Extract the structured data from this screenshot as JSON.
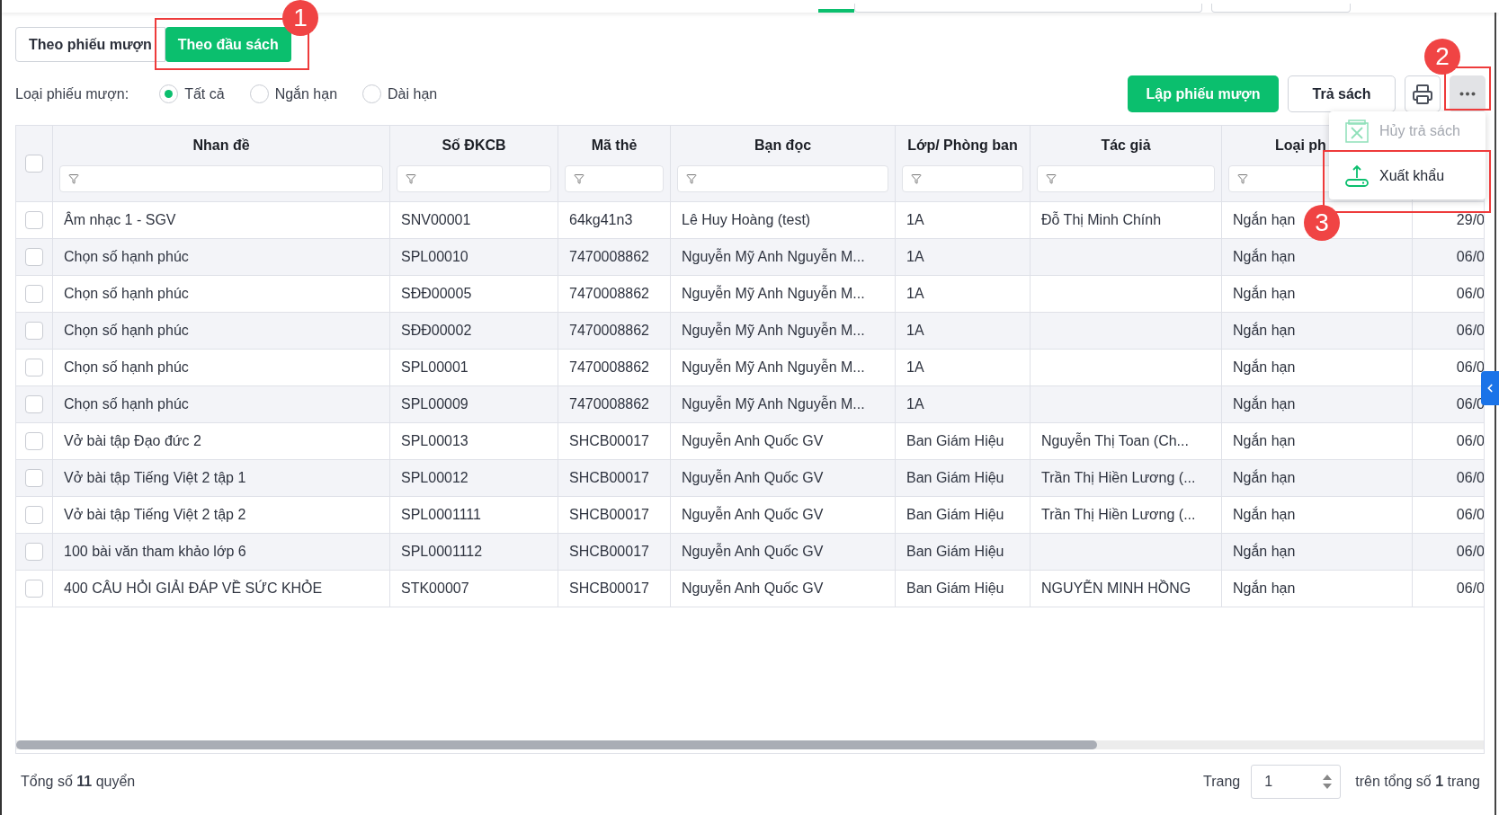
{
  "view_tabs": [
    {
      "label": "Theo phiếu mượn",
      "selected": false
    },
    {
      "label": "Theo đầu sách",
      "selected": true
    }
  ],
  "loan_type": {
    "label": "Loại phiếu mượn:",
    "options": [
      {
        "label": "Tất cả",
        "selected": true
      },
      {
        "label": "Ngắn hạn",
        "selected": false
      },
      {
        "label": "Dài hạn",
        "selected": false
      }
    ]
  },
  "toolbar": {
    "create_button": "Lập phiếu mượn",
    "return_button": "Trả sách"
  },
  "more_menu": [
    {
      "label": "Hủy trả sách",
      "kind": "cancel",
      "disabled": true
    },
    {
      "label": "Xuất khẩu",
      "kind": "export",
      "disabled": false
    }
  ],
  "table": {
    "header_checkbox": {
      "checked": false
    },
    "columns": [
      {
        "title": "Nhan đề"
      },
      {
        "title": "Số ĐKCB"
      },
      {
        "title": "Mã thẻ"
      },
      {
        "title": "Bạn đọc"
      },
      {
        "title": "Lớp/ Phòng ban"
      },
      {
        "title": "Tác giả"
      },
      {
        "title": "Loại ph"
      }
    ],
    "rows": [
      {
        "checked": false,
        "cells": [
          "Âm nhạc 1 - SGV",
          "SNV00001",
          "64kg41n3",
          "Lê Huy Hoàng (test)",
          "1A",
          "Đỗ Thị Minh Chính",
          "Ngắn hạn",
          "29/0"
        ]
      },
      {
        "checked": false,
        "cells": [
          "Chọn số hạnh phúc",
          "SPL00010",
          "7470008862",
          "Nguyễn Mỹ Anh Nguyễn M...",
          "1A",
          "",
          "Ngắn hạn",
          "06/0"
        ]
      },
      {
        "checked": false,
        "cells": [
          "Chọn số hạnh phúc",
          "SĐĐ00005",
          "7470008862",
          "Nguyễn Mỹ Anh Nguyễn M...",
          "1A",
          "",
          "Ngắn hạn",
          "06/0"
        ]
      },
      {
        "checked": false,
        "cells": [
          "Chọn số hạnh phúc",
          "SĐĐ00002",
          "7470008862",
          "Nguyễn Mỹ Anh Nguyễn M...",
          "1A",
          "",
          "Ngắn hạn",
          "06/0"
        ]
      },
      {
        "checked": false,
        "cells": [
          "Chọn số hạnh phúc",
          "SPL00001",
          "7470008862",
          "Nguyễn Mỹ Anh Nguyễn M...",
          "1A",
          "",
          "Ngắn hạn",
          "06/0"
        ]
      },
      {
        "checked": false,
        "cells": [
          "Chọn số hạnh phúc",
          "SPL00009",
          "7470008862",
          "Nguyễn Mỹ Anh Nguyễn M...",
          "1A",
          "",
          "Ngắn hạn",
          "06/0"
        ]
      },
      {
        "checked": false,
        "cells": [
          "Vở bài tập Đạo đức 2",
          "SPL00013",
          "SHCB00017",
          "Nguyễn Anh Quốc GV",
          "Ban Giám Hiệu",
          "Nguyễn Thị Toan (Ch...",
          "Ngắn hạn",
          "06/0"
        ]
      },
      {
        "checked": false,
        "cells": [
          "Vở bài tập Tiếng Việt 2 tập 1",
          "SPL00012",
          "SHCB00017",
          "Nguyễn Anh Quốc GV",
          "Ban Giám Hiệu",
          "Trần Thị Hiền Lương (...",
          "Ngắn hạn",
          "06/0"
        ]
      },
      {
        "checked": false,
        "cells": [
          "Vở bài tập Tiếng Việt 2 tập 2",
          "SPL0001111",
          "SHCB00017",
          "Nguyễn Anh Quốc GV",
          "Ban Giám Hiệu",
          "Trần Thị Hiền Lương (...",
          "Ngắn hạn",
          "06/0"
        ]
      },
      {
        "checked": false,
        "cells": [
          "100 bài văn tham khảo lớp 6",
          "SPL0001112",
          "SHCB00017",
          "Nguyễn Anh Quốc GV",
          "Ban Giám Hiệu",
          "",
          "Ngắn hạn",
          "06/0"
        ]
      },
      {
        "checked": false,
        "cells": [
          "400 CÂU HỎI GIẢI ĐÁP VỀ SỨC KHỎE",
          "STK00007",
          "SHCB00017",
          "Nguyễn Anh Quốc GV",
          "Ban Giám Hiệu",
          "NGUYỄN MINH HỒNG",
          "Ngắn hạn",
          "06/0"
        ]
      }
    ]
  },
  "footer": {
    "total": "Tổng số **11** quyển",
    "page_label": "Trang",
    "page_value": "1",
    "page_total": "trên tổng số **1** trang"
  },
  "annotations": [
    {
      "label": "1"
    },
    {
      "label": "2"
    },
    {
      "label": "3"
    }
  ]
}
